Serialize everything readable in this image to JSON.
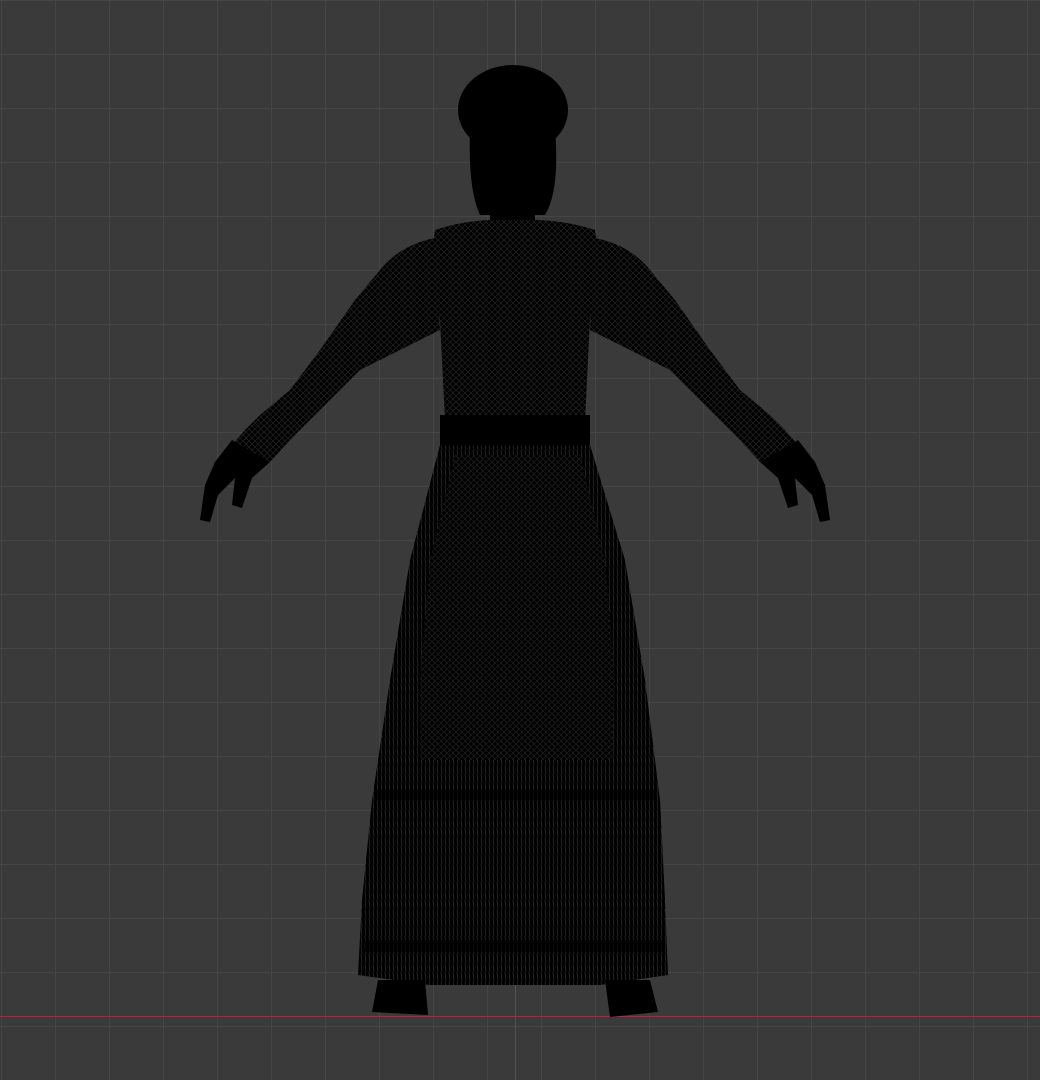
{
  "viewport": {
    "background_color": "#3a3a3a",
    "grid_color": "#454545",
    "y_axis_color": "#3f4aa8",
    "x_axis_color": "#8a3a3e",
    "mesh_color": "#000000",
    "wire_color": "#2c2c2c"
  },
  "scene": {
    "object": "wireframe-mesh-figure"
  }
}
